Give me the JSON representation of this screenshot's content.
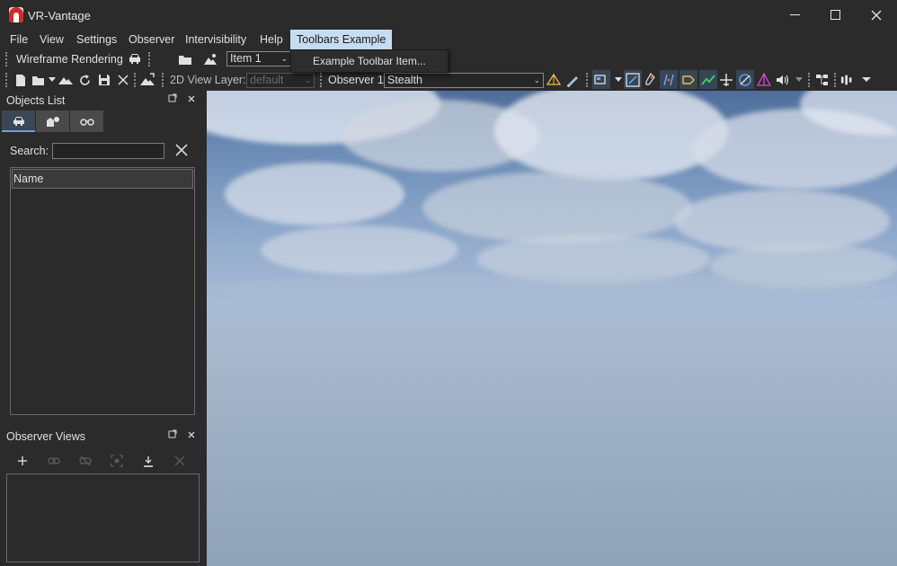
{
  "window": {
    "title": "VR-Vantage",
    "controls": {
      "minimize": "minimize",
      "maximize": "maximize",
      "close": "close"
    }
  },
  "menubar": {
    "items": [
      {
        "label": "File"
      },
      {
        "label": "View"
      },
      {
        "label": "Settings"
      },
      {
        "label": "Observer"
      },
      {
        "label": "Intervisibility"
      },
      {
        "label": "Help"
      },
      {
        "label": "Toolbars Example",
        "active": true
      }
    ]
  },
  "dropdown": {
    "items": [
      {
        "label": "Example Toolbar Item..."
      }
    ]
  },
  "toolbar1": {
    "wireframe_label": "Wireframe Rendering",
    "item_combo": {
      "value": "Item 1"
    }
  },
  "toolbar2": {
    "view_layer_label": "2D View Layer:",
    "view_layer_value": "default",
    "observer_label": "Observer 1",
    "observer_mode_value": "Stealth"
  },
  "objects_panel": {
    "title": "Objects List",
    "tabs": [
      "vehicles-tab",
      "buildings-tab",
      "observers-tab"
    ],
    "search_label": "Search:",
    "search_value": "",
    "column_header": "Name"
  },
  "observer_views_panel": {
    "title": "Observer Views",
    "tools": [
      "add",
      "link",
      "unlink",
      "capture",
      "download",
      "delete"
    ]
  },
  "colors": {
    "background": "#2b2b2b",
    "menu_active": "#c5dcf1",
    "sky_top": "#4d6d9a",
    "horizon": "#a9bcd6"
  }
}
